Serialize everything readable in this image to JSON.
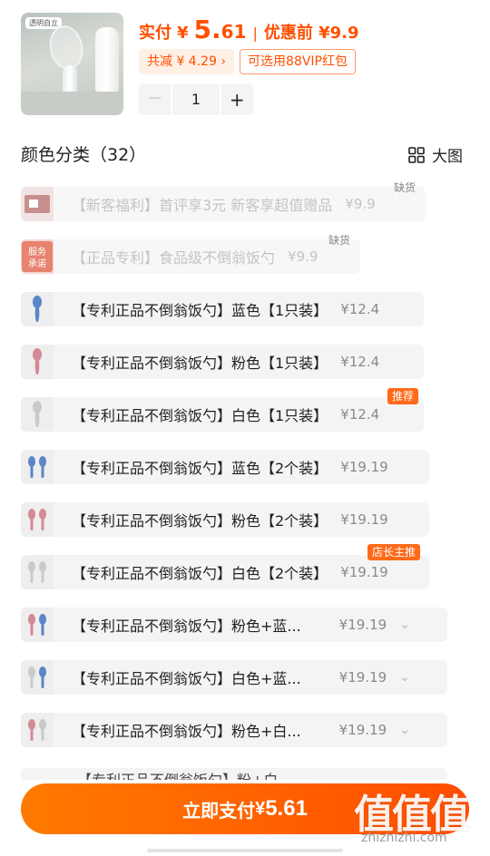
{
  "product": {
    "image_tag": "透明自立",
    "price_label": "实付",
    "currency": "¥",
    "price_int": "5.",
    "price_dec": "61",
    "separator": "|",
    "before_price": "优惠前 ¥9.9",
    "discount_total": "共减 ¥ 4.29 ›",
    "vip_coupon": "可选用88VIP红包"
  },
  "quantity": {
    "minus": "－",
    "value": "1",
    "plus": "+"
  },
  "options_header": {
    "title": "颜色分类（32）",
    "view_toggle": "大图"
  },
  "options": [
    {
      "name": "【新客福利】首评享3元 新客享超值赠品",
      "price": "¥9.9",
      "status": "缺货"
    },
    {
      "name": "【正品专利】食品级不倒翁饭勺",
      "price": "¥9.9",
      "status": "缺货"
    },
    {
      "name": "【专利正品不倒翁饭勺】蓝色【1只装】",
      "price": "¥12.4"
    },
    {
      "name": "【专利正品不倒翁饭勺】粉色【1只装】",
      "price": "¥12.4"
    },
    {
      "name": "【专利正品不倒翁饭勺】白色【1只装】",
      "price": "¥12.4",
      "badge": "推荐"
    },
    {
      "name": "【专利正品不倒翁饭勺】蓝色【2个装】",
      "price": "¥19.19"
    },
    {
      "name": "【专利正品不倒翁饭勺】粉色【2个装】",
      "price": "¥19.19"
    },
    {
      "name": "【专利正品不倒翁饭勺】白色【2个装】",
      "price": "¥19.19",
      "badge": "店长主推"
    },
    {
      "name": "【专利正品不倒翁饭勺】粉色+蓝...",
      "price": "¥19.19"
    },
    {
      "name": "【专利正品不倒翁饭勺】白色+蓝...",
      "price": "¥19.19"
    },
    {
      "name": "【专利正品不倒翁饭勺】粉色+白...",
      "price": "¥19.19"
    },
    {
      "name": "【专利正品不倒翁饭勺】粉+白..."
    }
  ],
  "footer": {
    "pay_label": "立即支付",
    "pay_currency": "¥",
    "pay_amount": "5.61",
    "watermark": "值值值",
    "watermark_url": "zhizhizhi.com"
  },
  "colors": {
    "accent": "#ff4f00",
    "badge": "#ff6a1a",
    "blue_spoon": "#5b86c7",
    "pink_spoon": "#d48a96",
    "white_spoon": "#c9cbcb"
  },
  "icons": {
    "grid": "grid-icon",
    "chevron": "chevron-down-icon",
    "spoon": "spoon-icon"
  }
}
